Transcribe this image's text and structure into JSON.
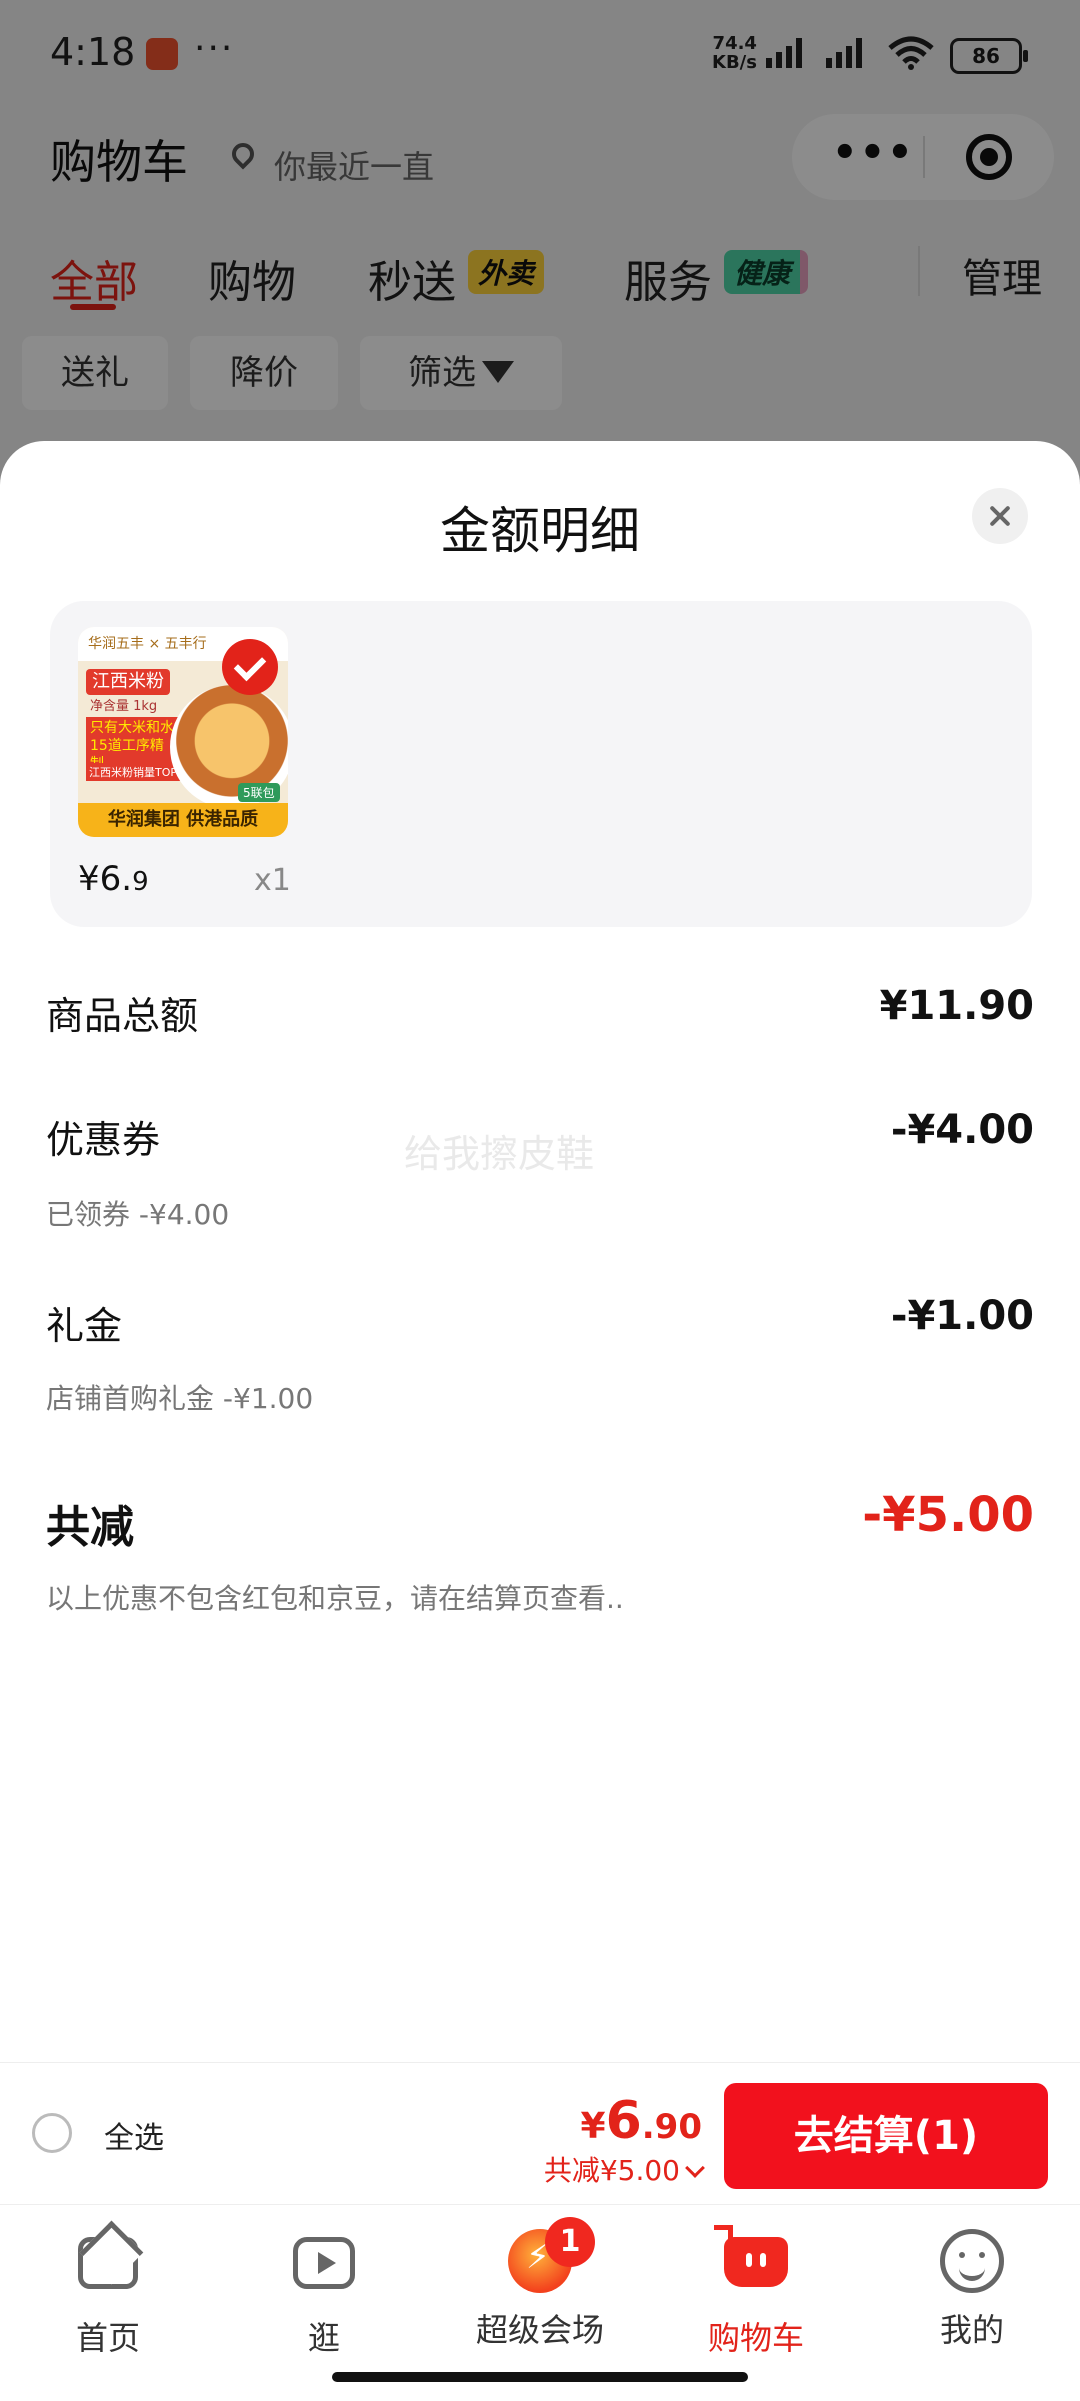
{
  "status_bar": {
    "time": "4:18",
    "dots": "···",
    "net_speed_value": "74.4",
    "net_speed_unit": "KB/s",
    "battery": "86"
  },
  "header": {
    "title": "购物车",
    "location": "你最近一直"
  },
  "tabs": [
    {
      "label": "全部",
      "active": true
    },
    {
      "label": "购物"
    },
    {
      "label": "秒送"
    },
    {
      "label": "服务"
    }
  ],
  "tab_badges": {
    "waimai": "外卖",
    "health": "健康"
  },
  "manage": "管理",
  "chips": [
    "送礼",
    "降价",
    "筛选"
  ],
  "sheet": {
    "title": "金额明细",
    "product": {
      "image_texts": {
        "brand": "华润五丰 × 五丰行",
        "name": "江西米粉",
        "weight": "净含量 1kg",
        "claim1": "只有大米和水",
        "claim2": "15道工序精制",
        "claim3": "江西米粉销量TOP1",
        "pack": "5联包",
        "footer": "华润集团  供港品质"
      },
      "price_int": "¥6.",
      "price_dec": "9",
      "qty": "x1"
    },
    "watermark": "给我擦皮鞋",
    "rows": [
      {
        "label": "商品总额",
        "value": "¥11.90"
      },
      {
        "label": "优惠券",
        "value": "-¥4.00",
        "sub": "已领券 -¥4.00"
      },
      {
        "label": "礼金",
        "value": "-¥1.00",
        "sub": "店铺首购礼金 -¥1.00"
      }
    ],
    "total": {
      "label": "共减",
      "value": "-¥5.00",
      "note": "以上优惠不包含红包和京豆，请在结算页查看.."
    }
  },
  "checkout": {
    "select_all": "全选",
    "price_symbol": "¥",
    "price_int": "6",
    "price_dec": ".90",
    "saved": "共减¥5.00",
    "button": "去结算(1)"
  },
  "nav": [
    {
      "label": "首页",
      "icon": "home-icon"
    },
    {
      "label": "逛",
      "icon": "video-icon"
    },
    {
      "label": "超级会场",
      "icon": "venue-icon",
      "badge": "1"
    },
    {
      "label": "购物车",
      "icon": "cart-icon",
      "active": true
    },
    {
      "label": "我的",
      "icon": "profile-icon"
    }
  ],
  "colors": {
    "accent": "#e2231a",
    "button": "#f2111d"
  }
}
